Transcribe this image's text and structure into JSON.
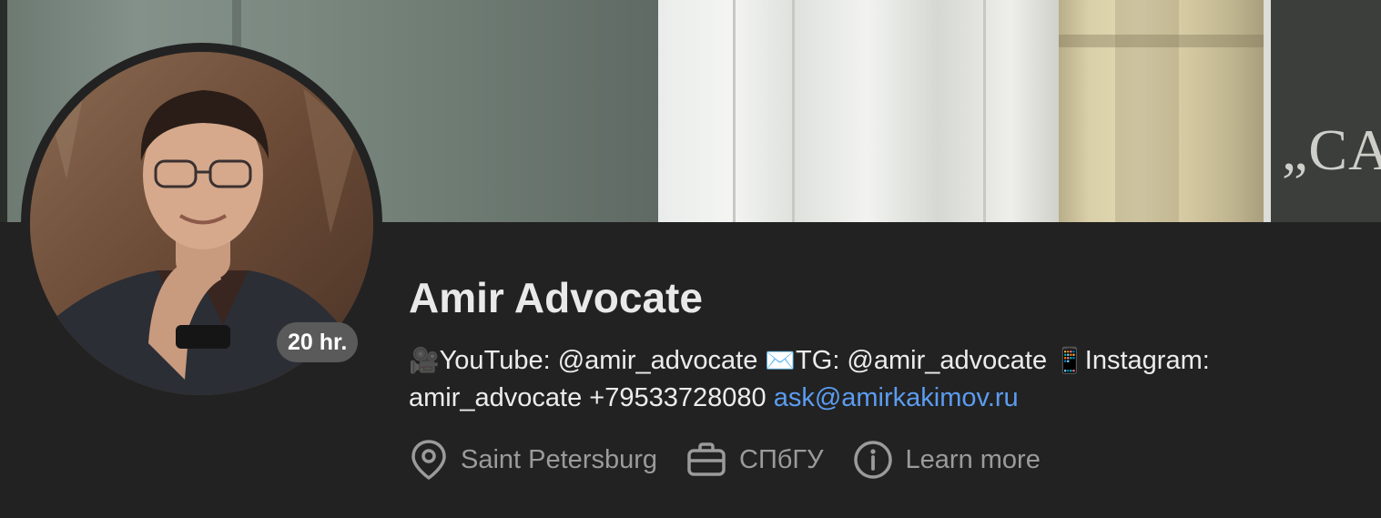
{
  "cover": {
    "plaque_text": "„CA"
  },
  "profile": {
    "name": "Amir Advocate",
    "duration_badge": "20 hr."
  },
  "bio": {
    "youtube_emoji": "🎥",
    "youtube_text": "YouTube: @amir_advocate",
    "tg_emoji": "✉️",
    "tg_text": "TG: @amir_advocate",
    "instagram_emoji": "📱",
    "instagram_text": "Instagram: amir_advocate +79533728080",
    "email": "ask@amirkakimov.ru"
  },
  "meta": {
    "location": "Saint Petersburg",
    "workplace": "СПбГУ",
    "learn_more": "Learn more"
  },
  "icons": {
    "location": "map-pin-icon",
    "workplace": "briefcase-icon",
    "learn_more": "info-circle-icon"
  },
  "colors": {
    "background": "#222222",
    "link": "#5b9cf0",
    "meta_text": "#9b9b9b",
    "name_text": "#e9e9e9"
  }
}
